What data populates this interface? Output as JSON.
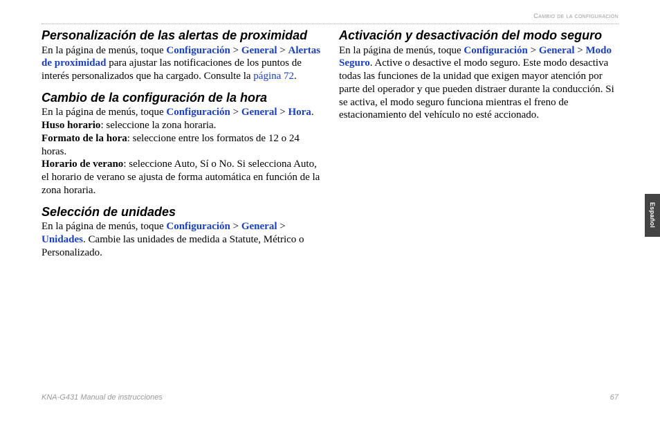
{
  "header": "Cambio de la configuración",
  "tab": "Español",
  "footer": {
    "left": "KNA-G431 Manual de instrucciones",
    "right": "67"
  },
  "alerts": {
    "heading": "Personalización de las alertas de proximidad",
    "intro": "En la página de menús, toque ",
    "nav1": "Configuración",
    "nav2": "General",
    "nav3": "Alertas de proximidad",
    "body": " para ajustar las notificaciones de los puntos de interés personalizados que ha cargado. Consulte la ",
    "link": "página 72",
    "end": "."
  },
  "time": {
    "heading": "Cambio de la configuración de la hora",
    "intro": "En la página de menús, toque ",
    "nav1": "Configuración",
    "nav2": "General",
    "nav3": "Hora",
    "end": ".",
    "tz_label": "Huso horario",
    "tz_body": ": seleccione la zona horaria.",
    "fmt_label": "Formato de la hora",
    "fmt_body": ": seleccione entre los formatos de 12 o 24 horas.",
    "dst_label": "Horario de verano",
    "dst_body": ": seleccione Auto, Sí o No. Si selecciona Auto, el horario de verano se ajusta de forma automática en función de la zona horaria."
  },
  "units": {
    "heading": "Selección de unidades",
    "intro": "En la página de menús, toque ",
    "nav1": "Configuración",
    "nav2": "General",
    "nav3": "Unidades",
    "body": ". Cambie las unidades de medida a Statute, Métrico o Personalizado."
  },
  "safe": {
    "heading": "Activación y desactivación del modo seguro",
    "intro": "En la página de menús, toque ",
    "nav1": "Configuración",
    "nav2": "General",
    "nav3": "Modo Seguro",
    "body": ". Active o desactive el modo seguro. Este modo desactiva todas las funciones de la unidad que exigen mayor atención por parte del operador y que pueden distraer durante la conducción. Si se activa, el modo seguro funciona mientras el freno de estacionamiento del vehículo no esté accionado."
  },
  "sep": " > "
}
